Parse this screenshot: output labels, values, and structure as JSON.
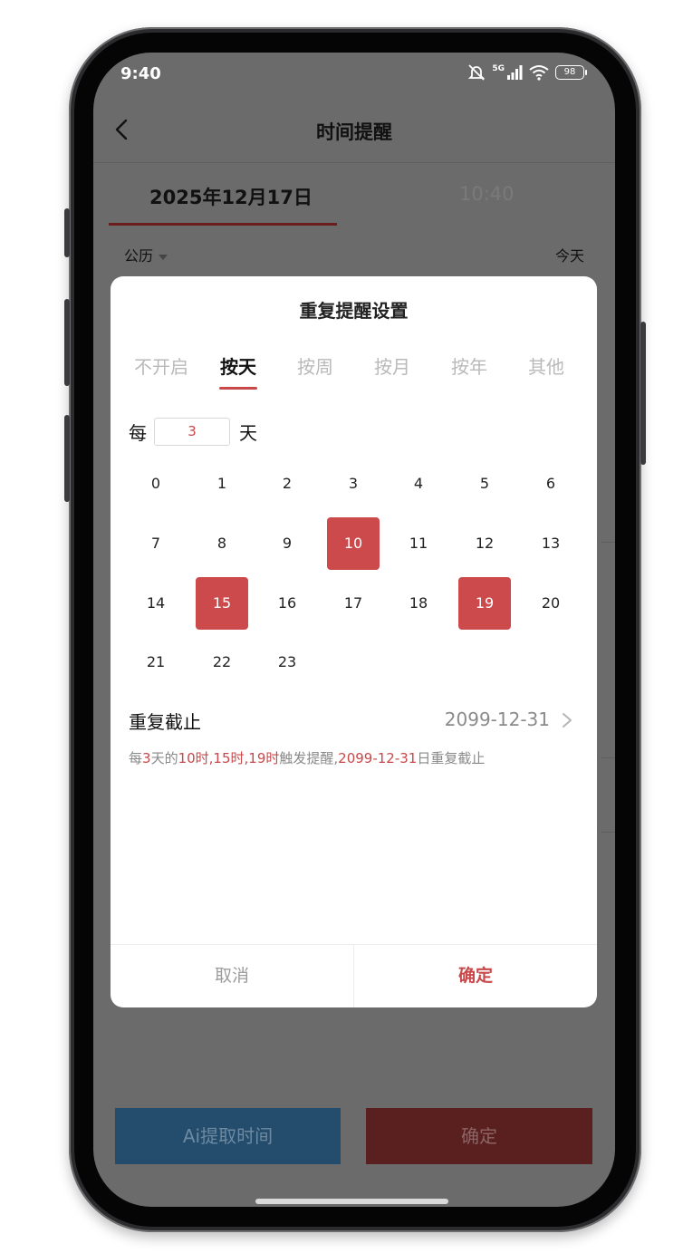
{
  "status_bar": {
    "time": "9:40",
    "network": "5G",
    "battery": "98"
  },
  "header": {
    "title": "时间提醒"
  },
  "picker_tabs": {
    "date": "2025年12月17日",
    "time": "10:40"
  },
  "calendar": {
    "type": "公历",
    "today": "今天"
  },
  "bottom_buttons": {
    "ai_extract": "Ai提取时间",
    "confirm": "确定"
  },
  "modal": {
    "title": "重复提醒设置",
    "modes": [
      "不开启",
      "按天",
      "按周",
      "按月",
      "按年",
      "其他"
    ],
    "active_mode": "按天",
    "interval_prefix": "每",
    "interval_value": "3",
    "interval_suffix": "天",
    "hours": [
      "0",
      "1",
      "2",
      "3",
      "4",
      "5",
      "6",
      "7",
      "8",
      "9",
      "10",
      "11",
      "12",
      "13",
      "14",
      "15",
      "16",
      "17",
      "18",
      "19",
      "20",
      "21",
      "22",
      "23"
    ],
    "selected_hours": [
      "10",
      "15",
      "19"
    ],
    "end_label": "重复截止",
    "end_value": "2099-12-31",
    "summary": {
      "p1": "每",
      "h1": "3",
      "p2": "天的",
      "h2": "10时,15时,19时",
      "p3": "触发提醒,",
      "h3": "2099-12-31",
      "p4": "日重复截止"
    },
    "cancel": "取消",
    "ok": "确定"
  },
  "colors": {
    "accent": "#cc4a4c",
    "overlay": "#6b6b6b",
    "ai_button": "#234c6d",
    "confirm_button": "#5a1f1f"
  }
}
